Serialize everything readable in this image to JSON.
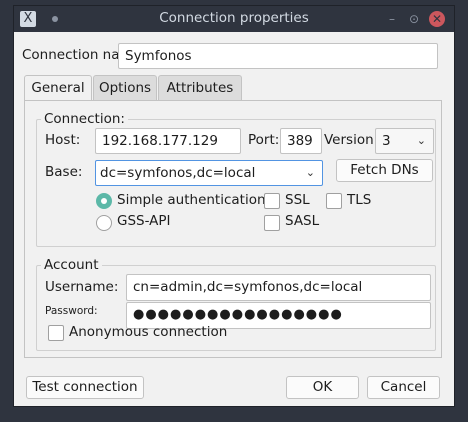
{
  "window": {
    "title": "Connection properties",
    "app_icon": "X",
    "dot_icon": "bullet-icon",
    "controls": {
      "minimize": "–",
      "maximize": "⊙",
      "close": "✕"
    }
  },
  "connection_name": {
    "label": "Connection nar",
    "value": "Symfonos"
  },
  "tabs": [
    {
      "label": "General",
      "active": true
    },
    {
      "label": "Options",
      "active": false
    },
    {
      "label": "Attributes",
      "active": false
    }
  ],
  "connection": {
    "group_title": "Connection:",
    "host_label": "Host:",
    "host_value": "192.168.177.129",
    "port_label": "Port:",
    "port_value": "389",
    "version_label": "Version:",
    "version_value": "3",
    "base_label": "Base:",
    "base_value": "dc=symfonos,dc=local",
    "fetch_dns_label": "Fetch DNs",
    "auth": [
      {
        "label": "Simple authentication",
        "checked": true
      },
      {
        "label": "GSS-API",
        "checked": false
      }
    ],
    "options": [
      {
        "label": "SSL",
        "checked": false
      },
      {
        "label": "TLS",
        "checked": false
      },
      {
        "label": "SASL",
        "checked": false
      }
    ]
  },
  "account": {
    "group_title": "Account",
    "username_label": "Username:",
    "username_value": "cn=admin,dc=symfonos,dc=local",
    "password_label": "Password:",
    "password_value": "●●●●●●●●●●●●●●●●●",
    "anonymous_label": "Anonymous connection",
    "anonymous_checked": false
  },
  "buttons": {
    "test": "Test connection",
    "ok": "OK",
    "cancel": "Cancel"
  },
  "colors": {
    "accent": "#5cb8a8",
    "titlebar": "#2f343f",
    "close": "#cc575d",
    "focus": "#5294e2"
  }
}
